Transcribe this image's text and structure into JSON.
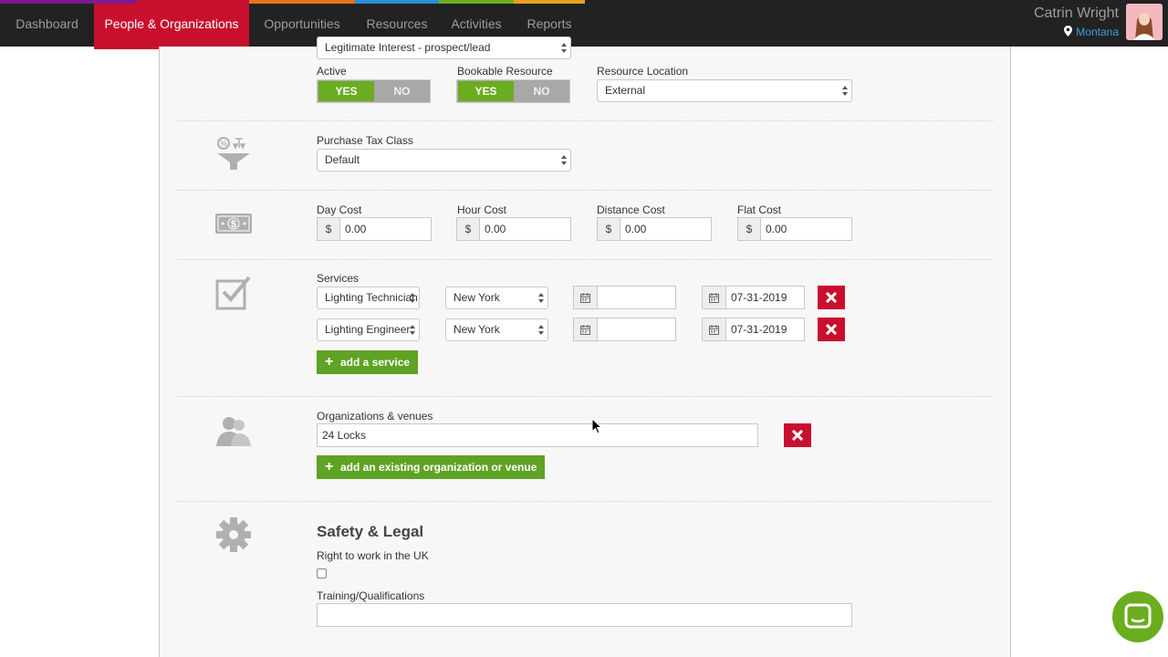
{
  "nav": {
    "tabs": [
      {
        "label": "Dashboard",
        "strip": "#222222"
      },
      {
        "label": "People & Organizations",
        "strip": "#7a1a8c"
      },
      {
        "label": "Opportunities",
        "strip": "#e8731c"
      },
      {
        "label": "Resources",
        "strip": "#2a8fd6"
      },
      {
        "label": "Activities",
        "strip": "#6aad1e"
      },
      {
        "label": "Reports",
        "strip": "#e8a01c"
      }
    ],
    "active_tab": "People & Organizations",
    "user": {
      "name": "Catrin Wright",
      "location": "Montana"
    }
  },
  "form": {
    "basis_select": "Legitimate Interest - prospect/lead",
    "active": {
      "label": "Active",
      "yes": "YES",
      "no": "NO",
      "value": "YES"
    },
    "bookable": {
      "label": "Bookable Resource",
      "yes": "YES",
      "no": "NO",
      "value": "YES"
    },
    "resource_location": {
      "label": "Resource Location",
      "value": "External"
    },
    "purchase_tax_class": {
      "label": "Purchase Tax Class",
      "value": "Default"
    },
    "costs": {
      "currency": "$",
      "day": {
        "label": "Day Cost",
        "value": "0.00"
      },
      "hour": {
        "label": "Hour Cost",
        "value": "0.00"
      },
      "distance": {
        "label": "Distance Cost",
        "value": "0.00"
      },
      "flat": {
        "label": "Flat Cost",
        "value": "0.00"
      }
    },
    "services": {
      "label": "Services",
      "rows": [
        {
          "service": "Lighting Technician",
          "location": "New York",
          "start": "",
          "end": "07-31-2019"
        },
        {
          "service": "Lighting Engineer",
          "location": "New York",
          "start": "",
          "end": "07-31-2019"
        }
      ],
      "add_label": "add a service"
    },
    "organizations": {
      "label": "Organizations & venues",
      "value": "24 Locks",
      "add_label": "add an existing organization or venue"
    },
    "safety": {
      "heading": "Safety & Legal",
      "right_to_work_label": "Right to work in the UK",
      "right_to_work_checked": false,
      "training_label": "Training/Qualifications",
      "training_value": ""
    }
  },
  "colors": {
    "brand_red": "#c8102e",
    "green": "#5ea324",
    "nav_bg": "#222222"
  }
}
